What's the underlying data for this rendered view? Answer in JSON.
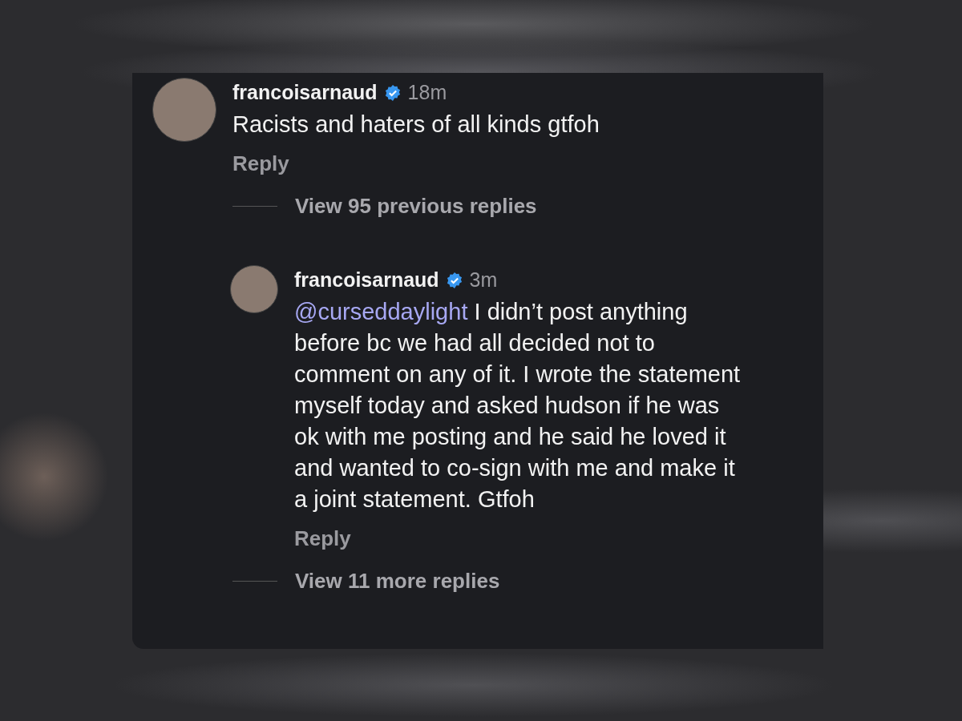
{
  "comments": [
    {
      "username": "francoisarnaud",
      "verified": true,
      "time": "18m",
      "text": "Racists and haters of all kinds gtfoh",
      "reply_label": "Reply",
      "replies_link": "View 95 previous replies",
      "replies": [
        {
          "username": "francoisarnaud",
          "verified": true,
          "time": "3m",
          "mention": "@curseddaylight",
          "text": "I didn’t post anything before bc we had all decided not to comment on any of it. I wrote the statement myself today and asked hudson if he was ok with me posting and he said he loved it and wanted to co-sign with me and make it a joint statement. Gtfoh",
          "reply_label": "Reply",
          "replies_link": "View 11 more replies"
        }
      ]
    }
  ]
}
